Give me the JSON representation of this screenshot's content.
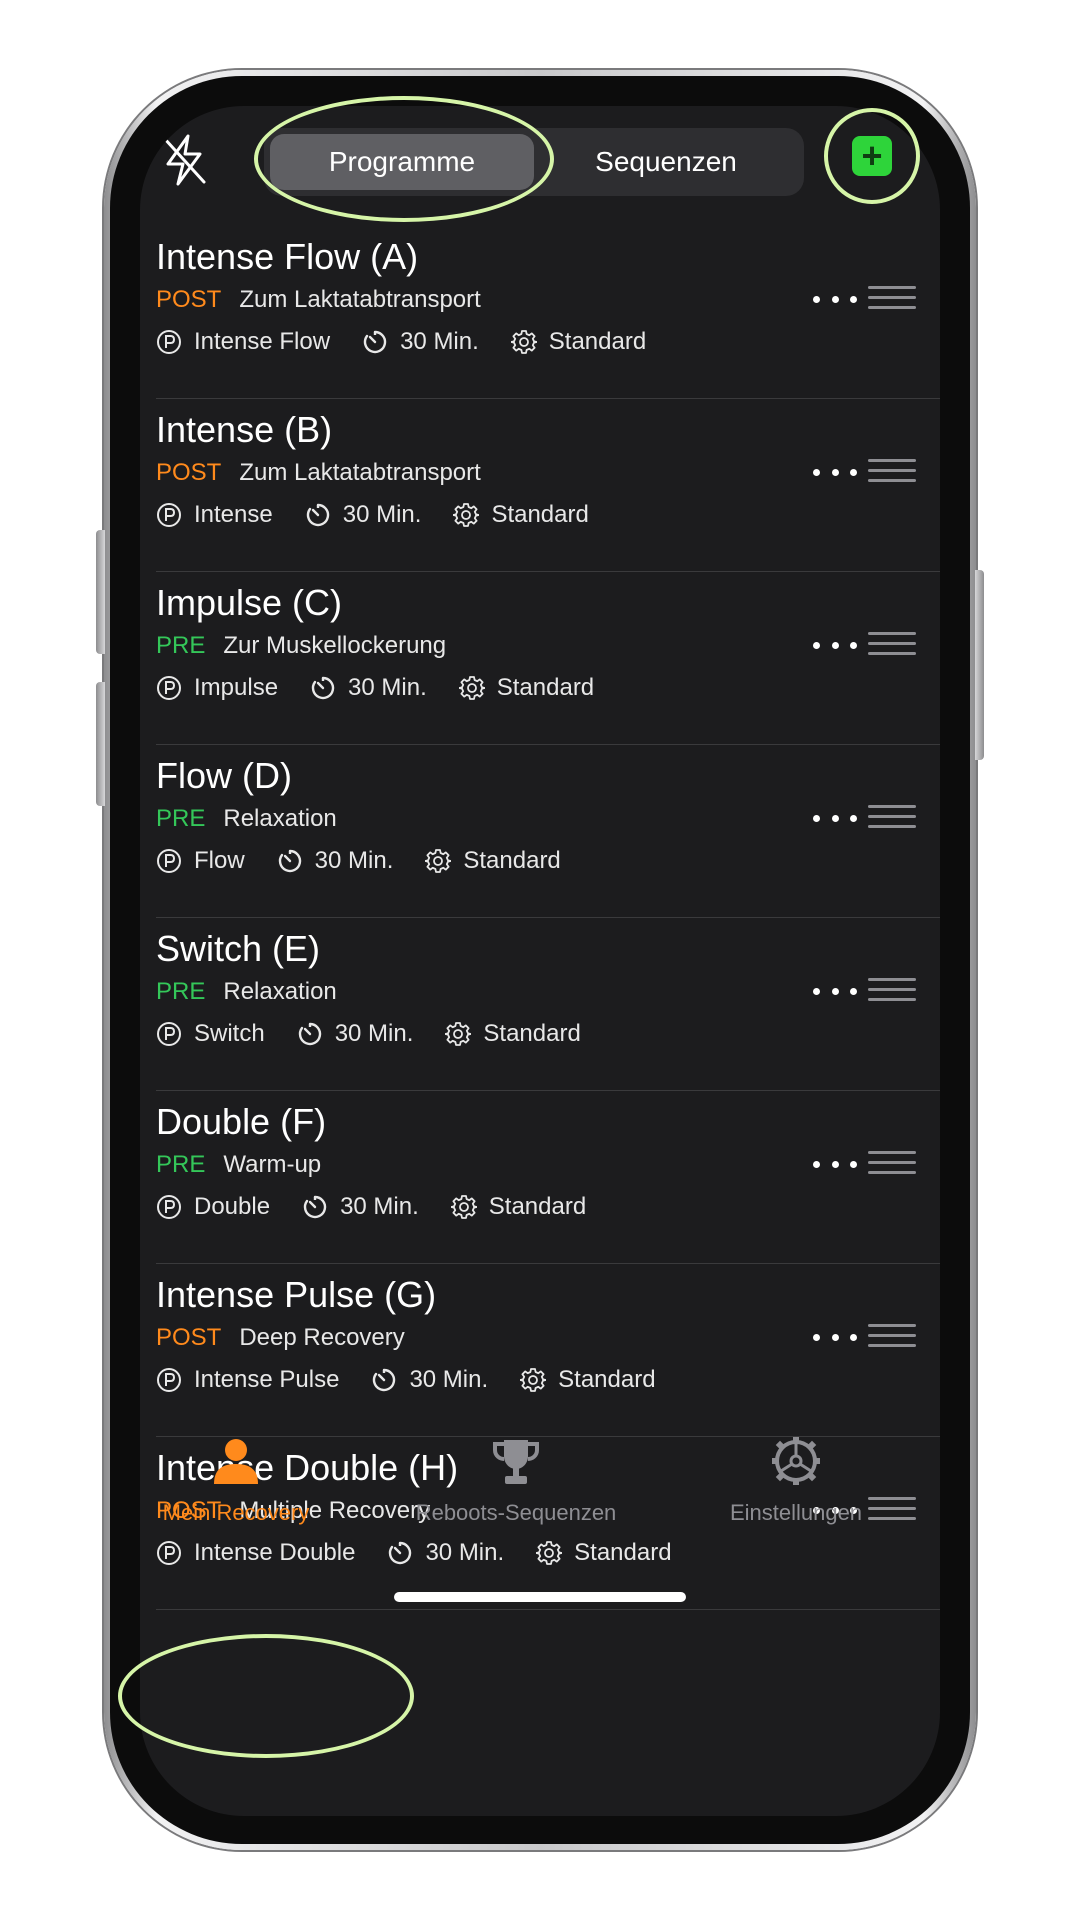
{
  "header": {
    "segments": [
      {
        "label": "Programme",
        "active": true
      },
      {
        "label": "Sequenzen",
        "active": false
      }
    ],
    "left_icon": "flash-off-icon",
    "add_icon": "plus-icon",
    "add_color": "#2ed43a"
  },
  "colors": {
    "background": "#1c1c1e",
    "post_tag": "#ff8a1c",
    "pre_tag": "#34c759",
    "active_tab": "#ff8a1c",
    "highlight": "#d6f5a8"
  },
  "programs": [
    {
      "title": "Intense Flow (A)",
      "tag": "POST",
      "description": "Zum Laktatabtransport",
      "program": "Intense Flow",
      "duration": "30 Min.",
      "setting": "Standard"
    },
    {
      "title": "Intense (B)",
      "tag": "POST",
      "description": "Zum Laktatabtransport",
      "program": "Intense",
      "duration": "30 Min.",
      "setting": "Standard"
    },
    {
      "title": "Impulse (C)",
      "tag": "PRE",
      "description": "Zur Muskellockerung",
      "program": "Impulse",
      "duration": "30 Min.",
      "setting": "Standard"
    },
    {
      "title": "Flow (D)",
      "tag": "PRE",
      "description": "Relaxation",
      "program": "Flow",
      "duration": "30 Min.",
      "setting": "Standard"
    },
    {
      "title": "Switch (E)",
      "tag": "PRE",
      "description": "Relaxation",
      "program": "Switch",
      "duration": "30 Min.",
      "setting": "Standard"
    },
    {
      "title": "Double (F)",
      "tag": "PRE",
      "description": "Warm-up",
      "program": "Double",
      "duration": "30 Min.",
      "setting": "Standard"
    },
    {
      "title": "Intense Pulse (G)",
      "tag": "POST",
      "description": "Deep Recovery",
      "program": "Intense Pulse",
      "duration": "30 Min.",
      "setting": "Standard"
    },
    {
      "title": "Intense Double (H)",
      "tag": "POST",
      "description": "Multiple Recovery",
      "program": "Intense Double",
      "duration": "30 Min.",
      "setting": "Standard"
    }
  ],
  "tabbar": {
    "tabs": [
      {
        "label": "Mein Recovery",
        "icon": "person-icon",
        "active": true
      },
      {
        "label": "Reboots-Sequenzen",
        "icon": "trophy-icon",
        "active": false
      },
      {
        "label": "Einstellungen",
        "icon": "settings-wheel-icon",
        "active": false
      }
    ]
  }
}
